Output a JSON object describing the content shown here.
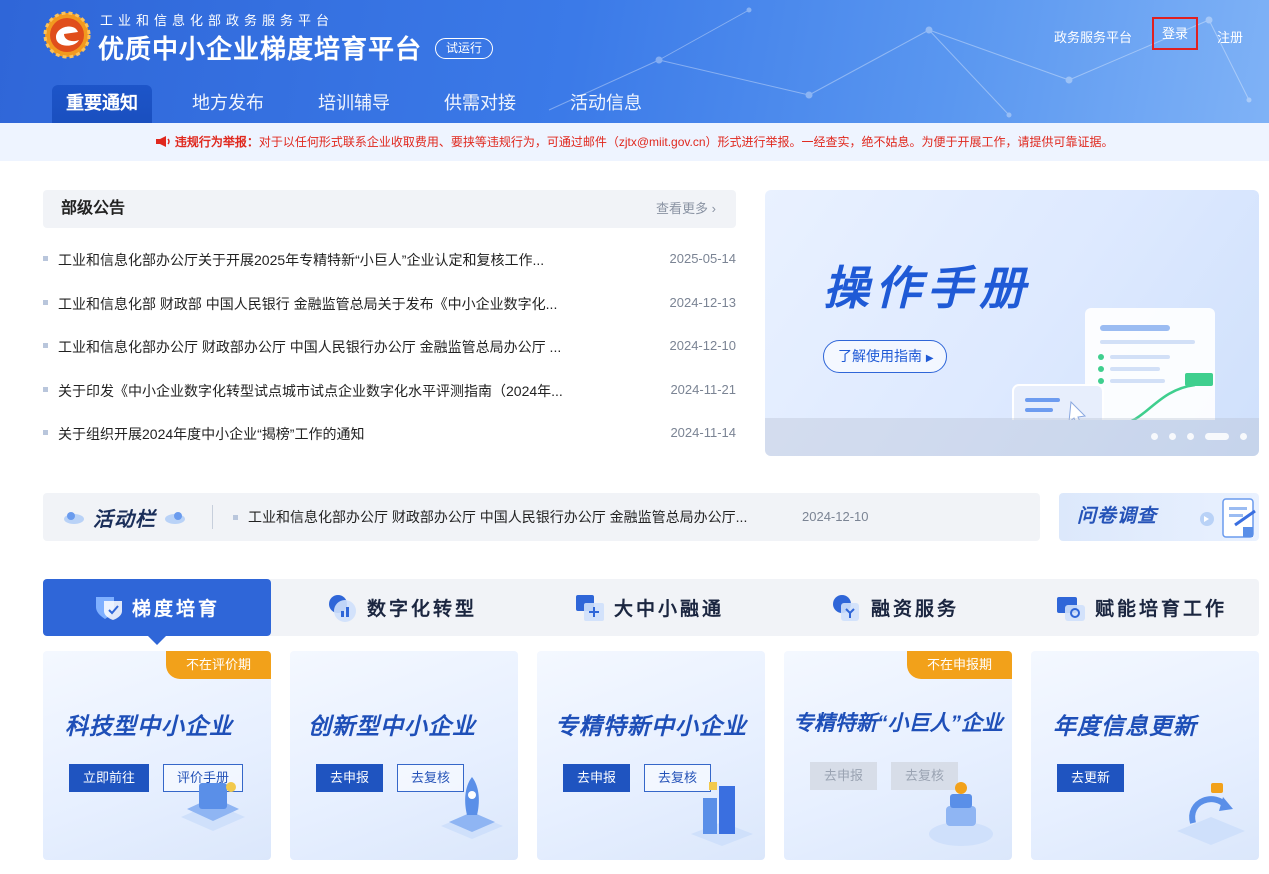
{
  "header": {
    "sub_title": "工业和信息化部政务服务平台",
    "main_title": "优质中小企业梯度培育平台",
    "trial_badge": "试运行",
    "links": {
      "gov_platform": "政务服务平台",
      "login": "登录",
      "register": "注册"
    },
    "nav": [
      {
        "label": "重要通知",
        "active": true
      },
      {
        "label": "地方发布"
      },
      {
        "label": "培训辅导"
      },
      {
        "label": "供需对接"
      },
      {
        "label": "活动信息"
      }
    ]
  },
  "notice": {
    "warn_label": "违规行为举报：",
    "text": "对于以任何形式联系企业收取费用、要挟等违规行为，可通过邮件（zjtx@miit.gov.cn）形式进行举报。一经查实，绝不姑息。为便于开展工作，请提供可靠证据。"
  },
  "announcements": {
    "title": "部级公告",
    "more": "查看更多",
    "items": [
      {
        "title": "工业和信息化部办公厅关于开展2025年专精特新“小巨人”企业认定和复核工作...",
        "date": "2025-05-14"
      },
      {
        "title": "工业和信息化部 财政部 中国人民银行 金融监管总局关于发布《中小企业数字化...",
        "date": "2024-12-13"
      },
      {
        "title": "工业和信息化部办公厅 财政部办公厅 中国人民银行办公厅 金融监管总局办公厅 ...",
        "date": "2024-12-10"
      },
      {
        "title": "关于印发《中小企业数字化转型试点城市试点企业数字化水平评测指南（2024年...",
        "date": "2024-11-21"
      },
      {
        "title": "关于组织开展2024年度中小企业“揭榜”工作的通知",
        "date": "2024-11-14"
      }
    ]
  },
  "banner": {
    "title": "操作手册",
    "button": "了解使用指南",
    "dots": 5,
    "active_dot": 4
  },
  "activity": {
    "title": "活动栏",
    "text": "工业和信息化部办公厅 财政部办公厅 中国人民银行办公厅 金融监管总局办公厅...",
    "date": "2024-12-10",
    "survey": "问卷调查"
  },
  "tabs": [
    {
      "label": "梯度培育",
      "active": true,
      "icon": "shield-icon"
    },
    {
      "label": "数字化转型",
      "icon": "chart-icon"
    },
    {
      "label": "大中小融通",
      "icon": "link-icon"
    },
    {
      "label": "融资服务",
      "icon": "coin-icon"
    },
    {
      "label": "赋能培育工作",
      "icon": "badge-icon"
    }
  ],
  "cards": [
    {
      "title": "科技型中小企业",
      "badge": "不在评价期",
      "buttons": [
        {
          "label": "立即前往",
          "style": "solid"
        },
        {
          "label": "评价手册",
          "style": "line"
        }
      ]
    },
    {
      "title": "创新型中小企业",
      "badge": "",
      "buttons": [
        {
          "label": "去申报",
          "style": "solid"
        },
        {
          "label": "去复核",
          "style": "line"
        }
      ]
    },
    {
      "title": "专精特新中小企业",
      "badge": "",
      "buttons": [
        {
          "label": "去申报",
          "style": "solid"
        },
        {
          "label": "去复核",
          "style": "line"
        }
      ]
    },
    {
      "title": "专精特新“小巨人”企业",
      "badge": "不在申报期",
      "buttons": [
        {
          "label": "去申报",
          "style": "disabled"
        },
        {
          "label": "去复核",
          "style": "disabled"
        }
      ]
    },
    {
      "title": "年度信息更新",
      "badge": "",
      "buttons": [
        {
          "label": "去更新",
          "style": "solid"
        }
      ]
    }
  ],
  "colors": {
    "brand": "#2f66d8",
    "warning": "#e0281e",
    "badge": "#f2a11a"
  }
}
